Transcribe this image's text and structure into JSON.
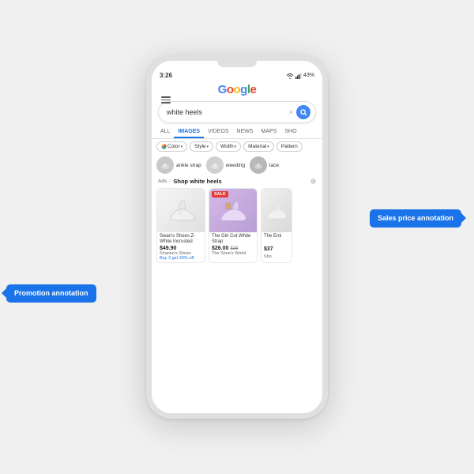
{
  "scene": {
    "bg_color": "#f0f0f0"
  },
  "phone": {
    "status": {
      "time": "3:26",
      "wifi": "WiFi",
      "signal": "Signal",
      "battery": "43%"
    },
    "google_logo": "Google",
    "search": {
      "query": "white heels",
      "clear_label": "×",
      "search_icon": "search"
    },
    "nav_tabs": [
      {
        "label": "ALL",
        "active": false
      },
      {
        "label": "IMAGES",
        "active": true
      },
      {
        "label": "VIDEOS",
        "active": false
      },
      {
        "label": "NEWS",
        "active": false
      },
      {
        "label": "MAPS",
        "active": false
      },
      {
        "label": "SHO",
        "active": false
      }
    ],
    "filters": [
      {
        "label": "Color",
        "has_arrow": true
      },
      {
        "label": "Style",
        "has_arrow": true
      },
      {
        "label": "Width",
        "has_arrow": true
      },
      {
        "label": "Material",
        "has_arrow": true
      },
      {
        "label": "Pattern",
        "has_arrow": false
      }
    ],
    "suggestions": [
      {
        "label": "ankle strap",
        "thumb_color": "#c8c8c8"
      },
      {
        "label": "weeding",
        "thumb_color": "#d0d0d0"
      },
      {
        "label": "lace",
        "thumb_color": "#b8b8b8"
      }
    ],
    "ads_section": {
      "ads_label": "Ads",
      "title": "Shop white heels",
      "info_icon": "info"
    },
    "products": [
      {
        "id": "p1",
        "name": "Swan's Shoes Z-White Incrusted",
        "price": "$49.90",
        "orig_price": null,
        "store": "Shanno's Shoes",
        "promo": "Buy 3 get 30% off",
        "sale_badge": null,
        "img_style": "white-1"
      },
      {
        "id": "p2",
        "name": "The Girl Cut White Strap",
        "price": "$26.00",
        "orig_price": "$38",
        "store": "The Shoe's World",
        "promo": null,
        "sale_badge": "SALE",
        "img_style": "purple"
      },
      {
        "id": "p3",
        "name": "The Emi",
        "price": "$37",
        "orig_price": null,
        "store": "Sho",
        "promo": null,
        "sale_badge": null,
        "img_style": "white-2"
      }
    ],
    "annotations": {
      "sales_price": "Sales price annotation",
      "promotion": "Promotion annotation"
    }
  }
}
